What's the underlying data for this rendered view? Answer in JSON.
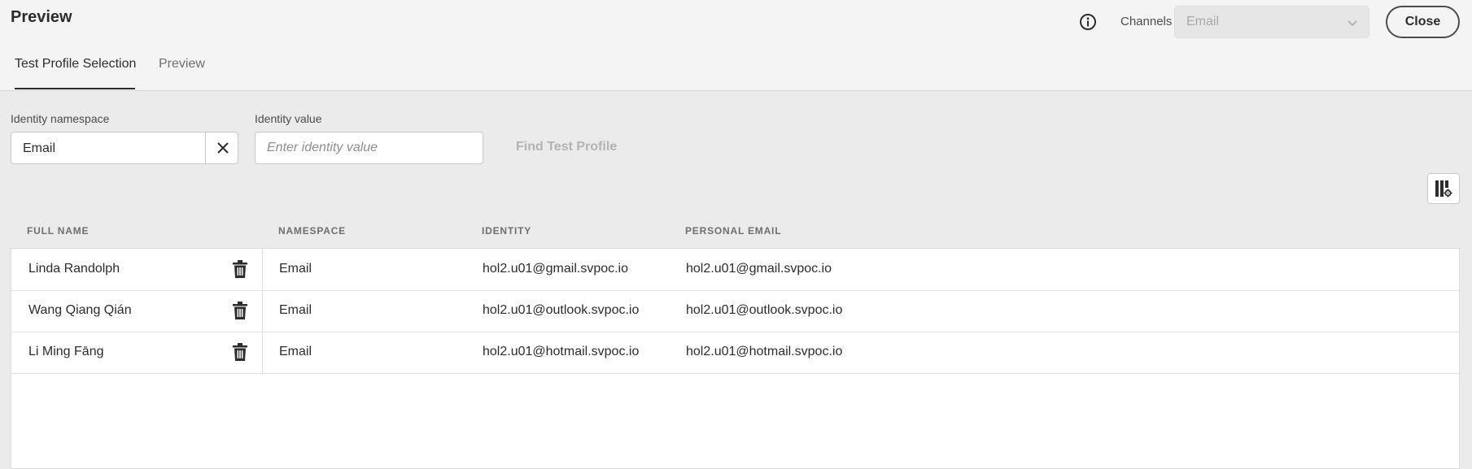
{
  "header": {
    "title": "Preview",
    "channels_label": "Channels",
    "channels_value": "Email",
    "close_label": "Close"
  },
  "tabs": [
    {
      "label": "Test Profile Selection",
      "active": true
    },
    {
      "label": "Preview",
      "active": false
    }
  ],
  "search": {
    "namespace_label": "Identity namespace",
    "namespace_value": "Email",
    "identity_label": "Identity value",
    "identity_placeholder": "Enter identity value",
    "find_label": "Find Test Profile"
  },
  "table": {
    "columns": [
      "FULL NAME",
      "NAMESPACE",
      "IDENTITY",
      "PERSONAL EMAIL"
    ],
    "rows": [
      {
        "full_name": "Linda Randolph",
        "namespace": "Email",
        "identity": "hol2.u01@gmail.svpoc.io",
        "personal_email": "hol2.u01@gmail.svpoc.io"
      },
      {
        "full_name": "Wang Qiang Qián",
        "namespace": "Email",
        "identity": "hol2.u01@outlook.svpoc.io",
        "personal_email": "hol2.u01@outlook.svpoc.io"
      },
      {
        "full_name": "Li Ming Fāng",
        "namespace": "Email",
        "identity": "hol2.u01@hotmail.svpoc.io",
        "personal_email": "hol2.u01@hotmail.svpoc.io"
      }
    ]
  },
  "icons": {
    "info": "info-icon",
    "chevron": "chevron-down-icon",
    "clear": "close-icon",
    "settings": "column-settings-icon",
    "delete": "trash-icon"
  }
}
